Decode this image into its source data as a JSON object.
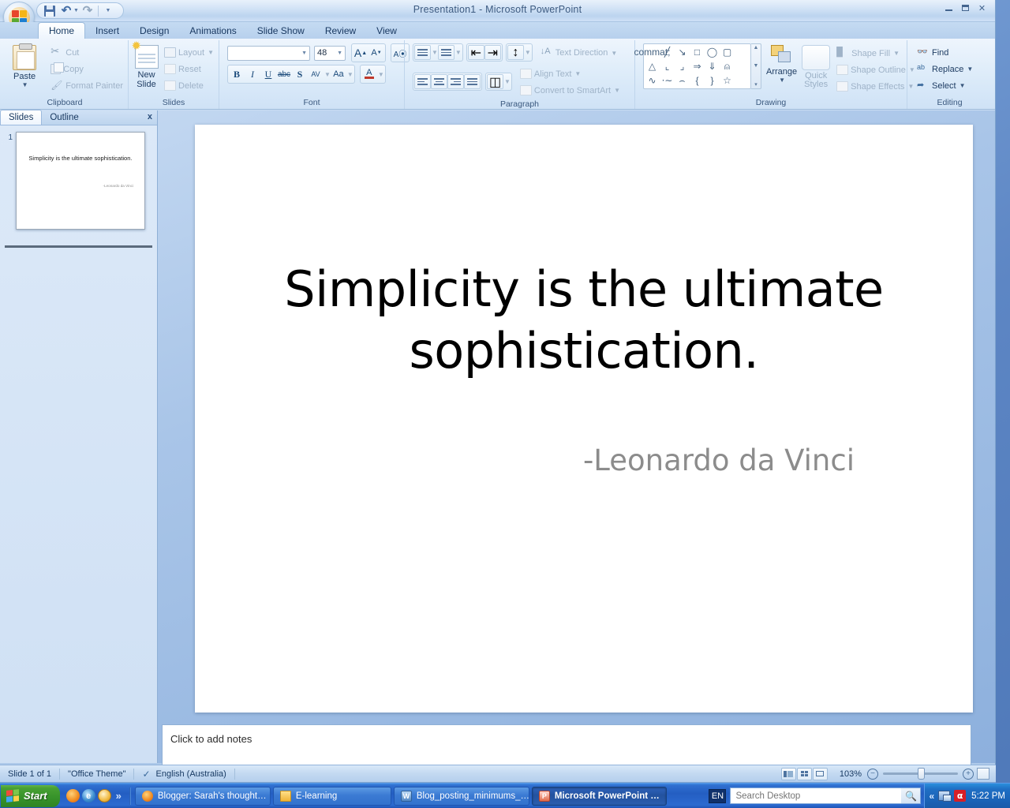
{
  "window": {
    "title": "Presentation1 - Microsoft PowerPoint",
    "minimize_label": "Minimize",
    "restore_label": "Restore Down",
    "close_label": "Close"
  },
  "quick_access": {
    "office_button": "Office Button",
    "save": "Save",
    "undo": "Undo",
    "redo": "Repeat",
    "customize": "Customize Quick Access Toolbar"
  },
  "ribbon": {
    "tabs": [
      {
        "label": "Home",
        "active": true
      },
      {
        "label": "Insert",
        "active": false
      },
      {
        "label": "Design",
        "active": false
      },
      {
        "label": "Animations",
        "active": false
      },
      {
        "label": "Slide Show",
        "active": false
      },
      {
        "label": "Review",
        "active": false
      },
      {
        "label": "View",
        "active": false
      }
    ],
    "groups": {
      "clipboard": {
        "label": "Clipboard",
        "paste": "Paste",
        "cut": "Cut",
        "copy": "Copy",
        "format_painter": "Format Painter"
      },
      "slides": {
        "label": "Slides",
        "new_slide": "New Slide",
        "layout": "Layout",
        "reset": "Reset",
        "delete": "Delete"
      },
      "font": {
        "label": "Font",
        "font_name": "",
        "font_name_placeholder": "",
        "font_size": "48",
        "grow_font": "Increase Font Size",
        "shrink_font": "Decrease Font Size",
        "clear_formatting": "Clear All Formatting",
        "bold": "B",
        "italic": "I",
        "underline": "U",
        "strikethrough": "abc",
        "shadow": "S",
        "char_spacing": "AV",
        "change_case": "Aa",
        "font_color": "A"
      },
      "paragraph": {
        "label": "Paragraph",
        "bullets": "Bullets",
        "numbering": "Numbering",
        "decrease_indent": "Decrease List Level",
        "increase_indent": "Increase List Level",
        "line_spacing": "Line Spacing",
        "text_direction": "Text Direction",
        "align_text": "Align Text",
        "convert_smartart": "Convert to SmartArt",
        "align_left": "Align Text Left",
        "align_center": "Center",
        "align_right": "Align Text Right",
        "justify": "Justify",
        "columns": "Columns"
      },
      "drawing": {
        "label": "Drawing",
        "shapes_row1": [
          "text-box",
          "line",
          "arrow",
          "rectangle",
          "oval",
          "rounded-rectangle"
        ],
        "shapes_row2": [
          "triangle",
          "elbow-connector",
          "elbow-arrow-connector",
          "right-arrow",
          "down-arrow",
          "pentagon-shape"
        ],
        "shapes_row3": [
          "freeform",
          "curve",
          "arc",
          "left-brace",
          "right-brace",
          "star"
        ],
        "arrange": "Arrange",
        "quick_styles": "Quick Styles",
        "shape_fill": "Shape Fill",
        "shape_outline": "Shape Outline",
        "shape_effects": "Shape Effects"
      },
      "editing": {
        "label": "Editing",
        "find": "Find",
        "replace": "Replace",
        "select": "Select"
      }
    }
  },
  "slide_panel": {
    "tabs": [
      {
        "label": "Slides",
        "active": true
      },
      {
        "label": "Outline",
        "active": false
      }
    ],
    "close": "x",
    "thumbnails": [
      {
        "number": "1",
        "title": "Simplicity is the ultimate sophistication.",
        "attribution": "-Leonardo da Vinci"
      }
    ]
  },
  "slide": {
    "title": "Simplicity is the ultimate sophistication.",
    "attribution": "-Leonardo da Vinci",
    "title_color": "#000000",
    "attribution_color": "#8c8c8c",
    "background_color": "#ffffff"
  },
  "notes": {
    "placeholder": "Click to add notes"
  },
  "status_bar": {
    "slide_indicator": "Slide 1 of 1",
    "theme": "\"Office Theme\"",
    "language": "English (Australia)",
    "spellcheck_icon": "proofing-icon",
    "view_normal": "Normal View",
    "view_sorter": "Slide Sorter",
    "view_show": "Slide Show",
    "zoom_level": "103%",
    "zoom_out": "−",
    "zoom_in": "+",
    "fit_to_window": "Fit slide to current window"
  },
  "taskbar": {
    "start": "Start",
    "quick_launch": [
      {
        "name": "firefox-icon"
      },
      {
        "name": "internet-explorer-icon"
      },
      {
        "name": "windows-media-player-icon"
      }
    ],
    "quick_launch_more": "»",
    "tasks": [
      {
        "label": "Blogger: Sarah's thought…",
        "icon": "firefox-icon",
        "active": false
      },
      {
        "label": "E-learning",
        "icon": "folder-icon",
        "active": false
      },
      {
        "label": "Blog_posting_minimums_…",
        "icon": "word-icon",
        "active": false
      },
      {
        "label": "Microsoft PowerPoint …",
        "icon": "powerpoint-icon",
        "active": true
      }
    ],
    "language_badge": "EN",
    "search": {
      "value": "",
      "placeholder": "Search Desktop",
      "icon": "search-icon"
    },
    "tray": {
      "expand": "«",
      "icons": [
        "network-icon",
        "antivirus-icon"
      ],
      "clock": "5:22 PM"
    }
  }
}
